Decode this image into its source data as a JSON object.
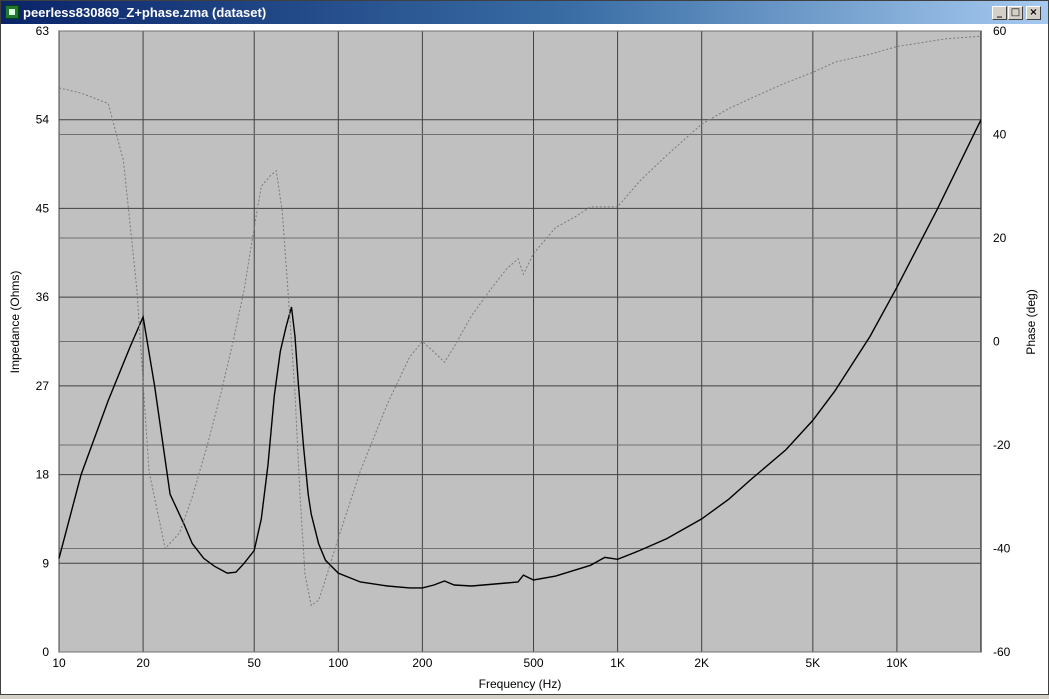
{
  "window": {
    "title": "peerless830869_Z+phase.zma (dataset)",
    "controls": {
      "minimize": "_",
      "maximize": "□",
      "close": "×"
    }
  },
  "colors": {
    "plot_bg": "#c0c0c0",
    "major_grid": "#404040",
    "minor_grid": "#707070",
    "impedance_line": "#000000",
    "phase_line": "#7a7a7a"
  },
  "chart_data": {
    "type": "line",
    "xlabel": "Frequency (Hz)",
    "ylabel": "Impedance (Ohms)",
    "y2label": "Phase (deg)",
    "x_scale": "log",
    "xlim": [
      10,
      20000
    ],
    "ylim": [
      0,
      63
    ],
    "y2lim": [
      -60,
      60
    ],
    "grid": true,
    "x_ticks": [
      {
        "v": 10,
        "label": "10"
      },
      {
        "v": 20,
        "label": "20"
      },
      {
        "v": 50,
        "label": "50"
      },
      {
        "v": 100,
        "label": "100"
      },
      {
        "v": 200,
        "label": "200"
      },
      {
        "v": 500,
        "label": "500"
      },
      {
        "v": 1000,
        "label": "1K"
      },
      {
        "v": 2000,
        "label": "2K"
      },
      {
        "v": 5000,
        "label": "5K"
      },
      {
        "v": 10000,
        "label": "10K"
      }
    ],
    "y_ticks": [
      0,
      9,
      18,
      27,
      36,
      45,
      54,
      63
    ],
    "y2_ticks": [
      -60,
      -40,
      -20,
      0,
      20,
      40,
      60
    ],
    "series": [
      {
        "axis": "left",
        "style": "solid",
        "x": [
          10,
          12,
          15,
          18,
          20,
          22,
          25,
          28,
          30,
          33,
          36,
          40,
          43,
          46,
          50,
          53,
          56,
          59,
          62,
          65,
          68,
          70,
          72,
          75,
          78,
          80,
          85,
          90,
          100,
          120,
          150,
          180,
          200,
          220,
          240,
          260,
          300,
          400,
          440,
          460,
          500,
          600,
          800,
          900,
          1000,
          1200,
          1500,
          2000,
          2500,
          3000,
          4000,
          5000,
          6000,
          8000,
          10000,
          14000,
          20000
        ],
        "y": [
          9.5,
          18,
          25.5,
          31,
          34,
          27,
          16,
          13,
          11,
          9.5,
          8.7,
          8.0,
          8.1,
          9.0,
          10.3,
          13.5,
          19,
          26,
          30.5,
          33,
          35,
          32,
          27,
          21,
          16,
          14,
          11,
          9.3,
          8.0,
          7.1,
          6.7,
          6.5,
          6.5,
          6.8,
          7.2,
          6.8,
          6.7,
          7.0,
          7.1,
          7.8,
          7.3,
          7.7,
          8.8,
          9.6,
          9.4,
          10.3,
          11.5,
          13.5,
          15.5,
          17.5,
          20.5,
          23.5,
          26.5,
          32,
          37,
          45,
          54
        ]
      },
      {
        "axis": "right",
        "style": "dotted",
        "x": [
          10,
          12,
          15,
          17,
          19,
          21,
          24,
          27,
          30,
          34,
          38,
          42,
          46,
          50,
          53,
          57,
          60,
          63,
          66,
          70,
          73,
          76,
          80,
          85,
          90,
          100,
          120,
          150,
          180,
          200,
          220,
          240,
          260,
          300,
          350,
          400,
          440,
          460,
          500,
          600,
          700,
          800,
          900,
          1000,
          1200,
          1500,
          2000,
          2500,
          3000,
          4000,
          5000,
          6000,
          8000,
          10000,
          15000,
          20000
        ],
        "y": [
          49,
          48,
          46,
          35,
          10,
          -25,
          -40,
          -37,
          -30,
          -20,
          -10,
          0,
          10,
          22,
          30,
          32,
          33,
          25,
          10,
          -10,
          -30,
          -45,
          -51,
          -50,
          -46,
          -38,
          -25,
          -12,
          -3,
          0,
          -2,
          -4,
          -1,
          5,
          10,
          14,
          16,
          13,
          17,
          22,
          24,
          26,
          26,
          26,
          31,
          36,
          42,
          45,
          47,
          50,
          52,
          54,
          55.5,
          57,
          58.5,
          59
        ]
      }
    ]
  }
}
